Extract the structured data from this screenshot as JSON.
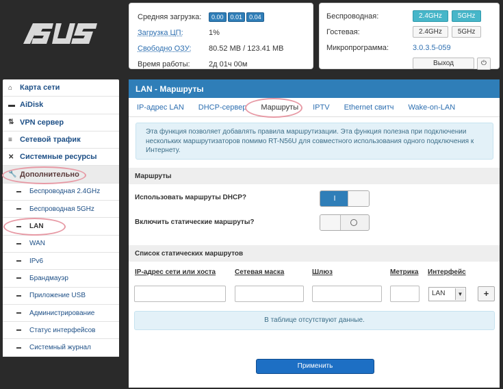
{
  "brand": {
    "logo_text": "ASUS"
  },
  "system": {
    "load_label": "Средняя загрузка:",
    "load_values": [
      "0.00",
      "0.01",
      "0.04"
    ],
    "cpu_label": "Загрузка ЦП:",
    "cpu_value": "1%",
    "ram_label": "Свободно ОЗУ:",
    "ram_value": "80.52 MB / 123.41 MB",
    "uptime_label": "Время работы:",
    "uptime_value": "2д 01ч 00м"
  },
  "network": {
    "wireless_label": "Беспроводная:",
    "guest_label": "Гостевая:",
    "band_24": "2.4GHz",
    "band_5": "5GHz",
    "firmware_label": "Микропрограмма:",
    "firmware_value": "3.0.3.5-059",
    "logout_label": "Выход"
  },
  "sidebar": {
    "items": [
      {
        "label": "Карта сети"
      },
      {
        "label": "AiDisk"
      },
      {
        "label": "VPN сервер"
      },
      {
        "label": "Сетевой трафик"
      },
      {
        "label": "Системные ресурсы"
      },
      {
        "label": "Дополнительно"
      }
    ],
    "sub": [
      {
        "label": "Беспроводная 2.4GHz"
      },
      {
        "label": "Беспроводная 5GHz"
      },
      {
        "label": "LAN"
      },
      {
        "label": "WAN"
      },
      {
        "label": "IPv6"
      },
      {
        "label": "Брандмауэр"
      },
      {
        "label": "Приложение USB"
      },
      {
        "label": "Администрирование"
      },
      {
        "label": "Статус интерфейсов"
      },
      {
        "label": "Системный журнал"
      }
    ]
  },
  "main": {
    "title": "LAN - Маршруты",
    "tabs": [
      {
        "label": "IP-адрес LAN"
      },
      {
        "label": "DHCP-сервер"
      },
      {
        "label": "Маршруты"
      },
      {
        "label": "IPTV"
      },
      {
        "label": "Ethernet свитч"
      },
      {
        "label": "Wake-on-LAN"
      }
    ],
    "info_text": "Эта функция позволяет добавлять правила маршрутизации. Эта функция полезна при подключении нескольких маршрутизаторов помимо RT-N56U для совместного использования одного подключения к Интернету.",
    "routes_section": "Маршруты",
    "dhcp_routes_label": "Использовать маршруты DHCP?",
    "dhcp_routes_on": "I",
    "static_routes_label": "Включить статические маршруты?",
    "list_section": "Список статических маршрутов",
    "columns": {
      "host": "IP-адрес сети или хоста",
      "mask": "Сетевая маска",
      "gateway": "Шлюз",
      "metric": "Метрика",
      "iface": "Интерфейс"
    },
    "iface_selected": "LAN",
    "add_label": "+",
    "empty_text": "В таблице отсутствуют данные.",
    "apply_label": "Применить"
  }
}
